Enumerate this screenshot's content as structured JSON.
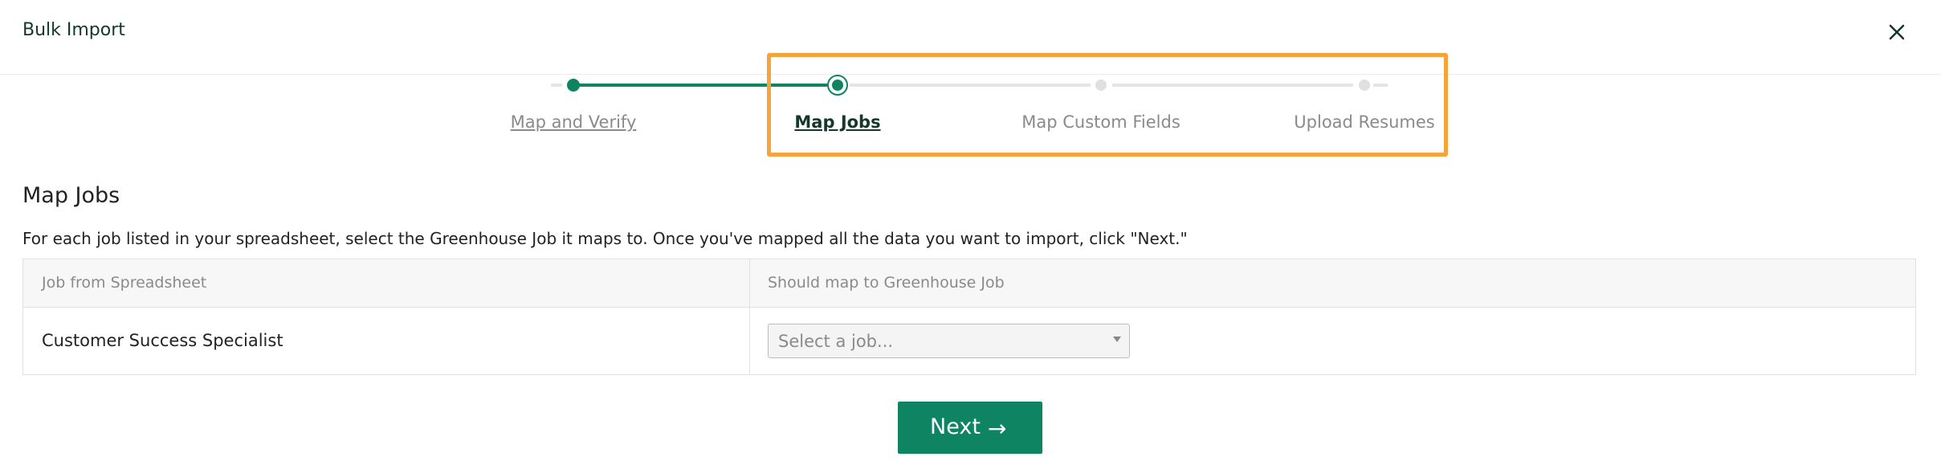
{
  "header": {
    "title": "Bulk Import",
    "close_icon": "close-icon"
  },
  "stepper": {
    "steps": [
      {
        "label": "Map and Verify",
        "state": "completed"
      },
      {
        "label": "Map Jobs",
        "state": "current"
      },
      {
        "label": "Map Custom Fields",
        "state": "upcoming"
      },
      {
        "label": "Upload Resumes",
        "state": "upcoming"
      }
    ],
    "colors": {
      "completed": "#0e8463",
      "upcoming": "#e5e5e5",
      "highlight": "#f5a33a"
    }
  },
  "section": {
    "title": "Map Jobs",
    "description": "For each job listed in your spreadsheet, select the Greenhouse Job it maps to. Once you've mapped all the data you want to import, click \"Next.\""
  },
  "table": {
    "headers": [
      "Job from Spreadsheet",
      "Should map to Greenhouse Job"
    ],
    "rows": [
      {
        "job": "Customer Success Specialist",
        "select_placeholder": "Select a job..."
      }
    ]
  },
  "footer": {
    "next_label": "Next",
    "next_arrow": "→"
  }
}
